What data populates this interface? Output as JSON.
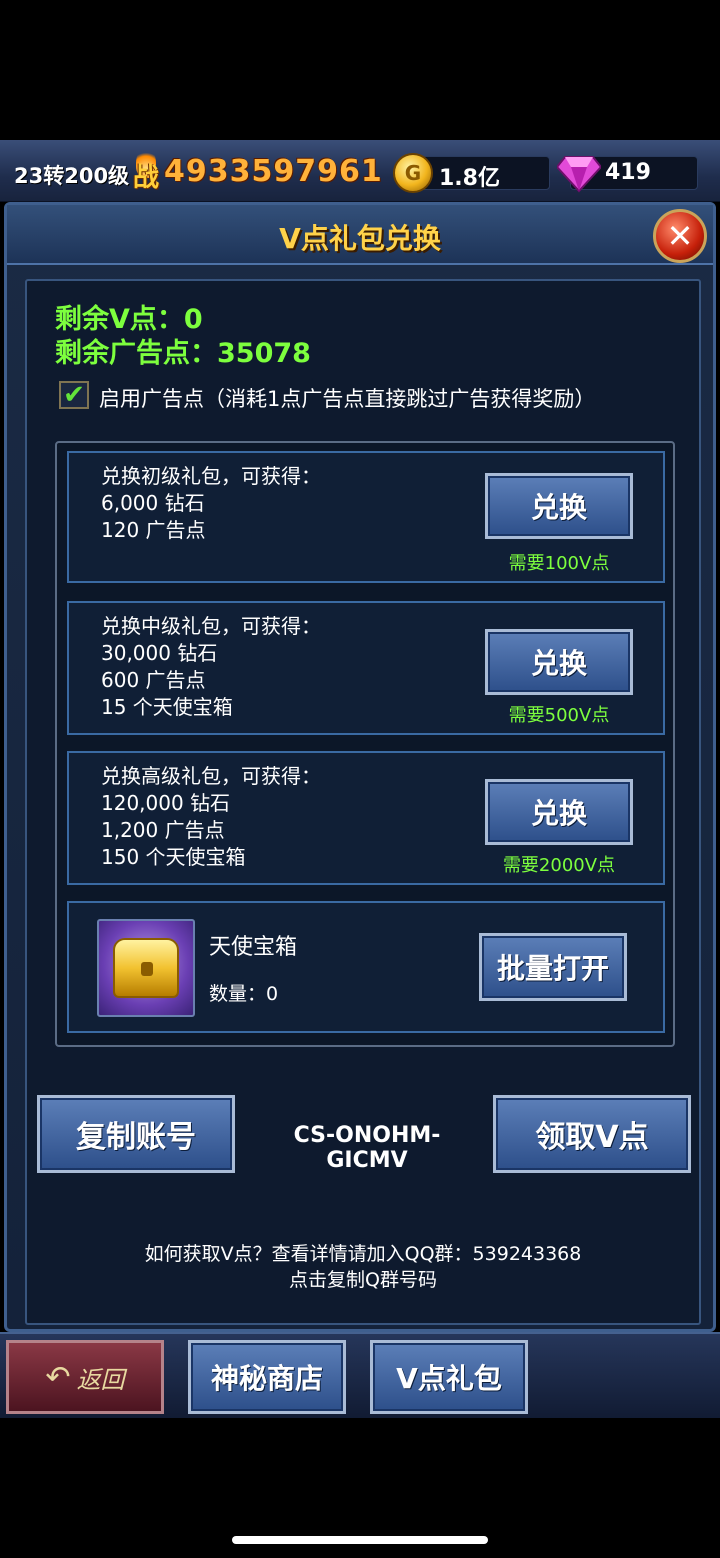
{
  "resource_bar": {
    "level": "23转200级",
    "power_label": "战",
    "power": "4933597961",
    "gold_icon_letter": "G",
    "gold": "1.8亿",
    "diamonds": "419"
  },
  "panel": {
    "title": "V点礼包兑换",
    "close_icon": "close-icon",
    "remaining_v": "剩余V点：0",
    "remaining_ad": "剩余广告点：35078",
    "use_ad_points_checked": true,
    "use_ad_points_label": "启用广告点（消耗1点广告点直接跳过广告获得奖励）"
  },
  "packages": [
    {
      "lines": [
        "兑换初级礼包，可获得：",
        "6,000 钻石",
        "120 广告点"
      ],
      "button": "兑换",
      "cost": "需要100V点"
    },
    {
      "lines": [
        "兑换中级礼包，可获得：",
        "30,000 钻石",
        "600 广告点",
        "15 个天使宝箱"
      ],
      "button": "兑换",
      "cost": "需要500V点"
    },
    {
      "lines": [
        "兑换高级礼包，可获得：",
        "120,000 钻石",
        "1,200 广告点",
        "150 个天使宝箱"
      ],
      "button": "兑换",
      "cost": "需要2000V点"
    }
  ],
  "chest": {
    "name": "天使宝箱",
    "quantity": "数量：0",
    "open_button": "批量打开"
  },
  "account": {
    "copy_button": "复制账号",
    "account_id": "CS-ONOHM-GICMV",
    "claim_button": "领取V点"
  },
  "help": {
    "line1": "如何获取V点？查看详情请加入QQ群：539243368",
    "line2": "点击复制Q群号码"
  },
  "bottom_nav": {
    "back": "返回",
    "shop": "神秘商店",
    "vgift": "V点礼包"
  },
  "colors": {
    "green_text": "#7dff3e",
    "gold_title": "#ffd24a",
    "button_blue": "#2d4f8a"
  }
}
